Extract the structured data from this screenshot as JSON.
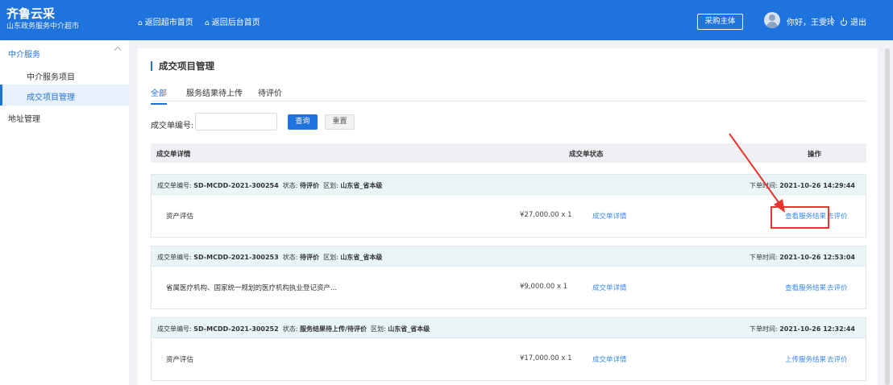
{
  "header": {
    "logo_title": "齐鲁云采",
    "logo_subtitle": "山东政务服务中介超市",
    "nav_links": [
      "返回超市首页",
      "返回后台首页"
    ],
    "purchase_button": "采购主体",
    "greeting": "你好，王雯玲",
    "separator": "|",
    "logout": "退出"
  },
  "sidebar": {
    "group_label": "中介服务",
    "items": [
      {
        "label": "中介服务项目",
        "active": false
      },
      {
        "label": "成交项目管理",
        "active": true
      }
    ],
    "top_item": "地址管理"
  },
  "main": {
    "title": "成交项目管理",
    "tabs": [
      {
        "label": "全部",
        "active": true
      },
      {
        "label": "服务结果待上传",
        "active": false
      },
      {
        "label": "待评价",
        "active": false
      }
    ],
    "search": {
      "label": "成交单编号:",
      "value": "",
      "query_button": "查询",
      "reset_button": "重置"
    },
    "table_headers": [
      "成交单详情",
      "成交单状态",
      "操作"
    ],
    "orders": [
      {
        "no_label": "成交单编号:",
        "no": "SD-MCDD-2021-300254",
        "status_label": "状态:",
        "status": "待评价",
        "region_label": "区划:",
        "region": "山东省_省本级",
        "time_label": "下单时间:",
        "time": "2021-10-26 14:29:44",
        "item_name": "资产评估",
        "price": "¥27,000.00 x 1",
        "detail_link": "成交单详情",
        "action_primary": "查看服务结果",
        "action_secondary": "去评价"
      },
      {
        "no_label": "成交单编号:",
        "no": "SD-MCDD-2021-300253",
        "status_label": "状态:",
        "status": "待评价",
        "region_label": "区划:",
        "region": "山东省_省本级",
        "time_label": "下单时间:",
        "time": "2021-10-26 12:53:04",
        "item_name": "省属医疗机构、国家统一规划的医疗机构执业登记资产...",
        "price": "¥9,000.00 x 1",
        "detail_link": "成交单详情",
        "action_primary": "查看服务结果",
        "action_secondary": "去评价"
      },
      {
        "no_label": "成交单编号:",
        "no": "SD-MCDD-2021-300252",
        "status_label": "状态:",
        "status": "服务结果待上传/待评价",
        "region_label": "区划:",
        "region": "山东省_省本级",
        "time_label": "下单时间:",
        "time": "2021-10-26 12:32:44",
        "item_name": "资产评估",
        "price": "¥17,000.00 x 1",
        "detail_link": "成交单详情",
        "action_primary": "上传服务结果",
        "action_secondary": "去评价"
      }
    ]
  },
  "colors": {
    "primary": "#1f73dd",
    "link": "#3b8be8",
    "annotation_red": "#e8362e",
    "order_header_bg": "#eaf5f8"
  },
  "icons": [
    "home-icon",
    "avatar-icon",
    "power-icon",
    "chevron-up-icon"
  ]
}
